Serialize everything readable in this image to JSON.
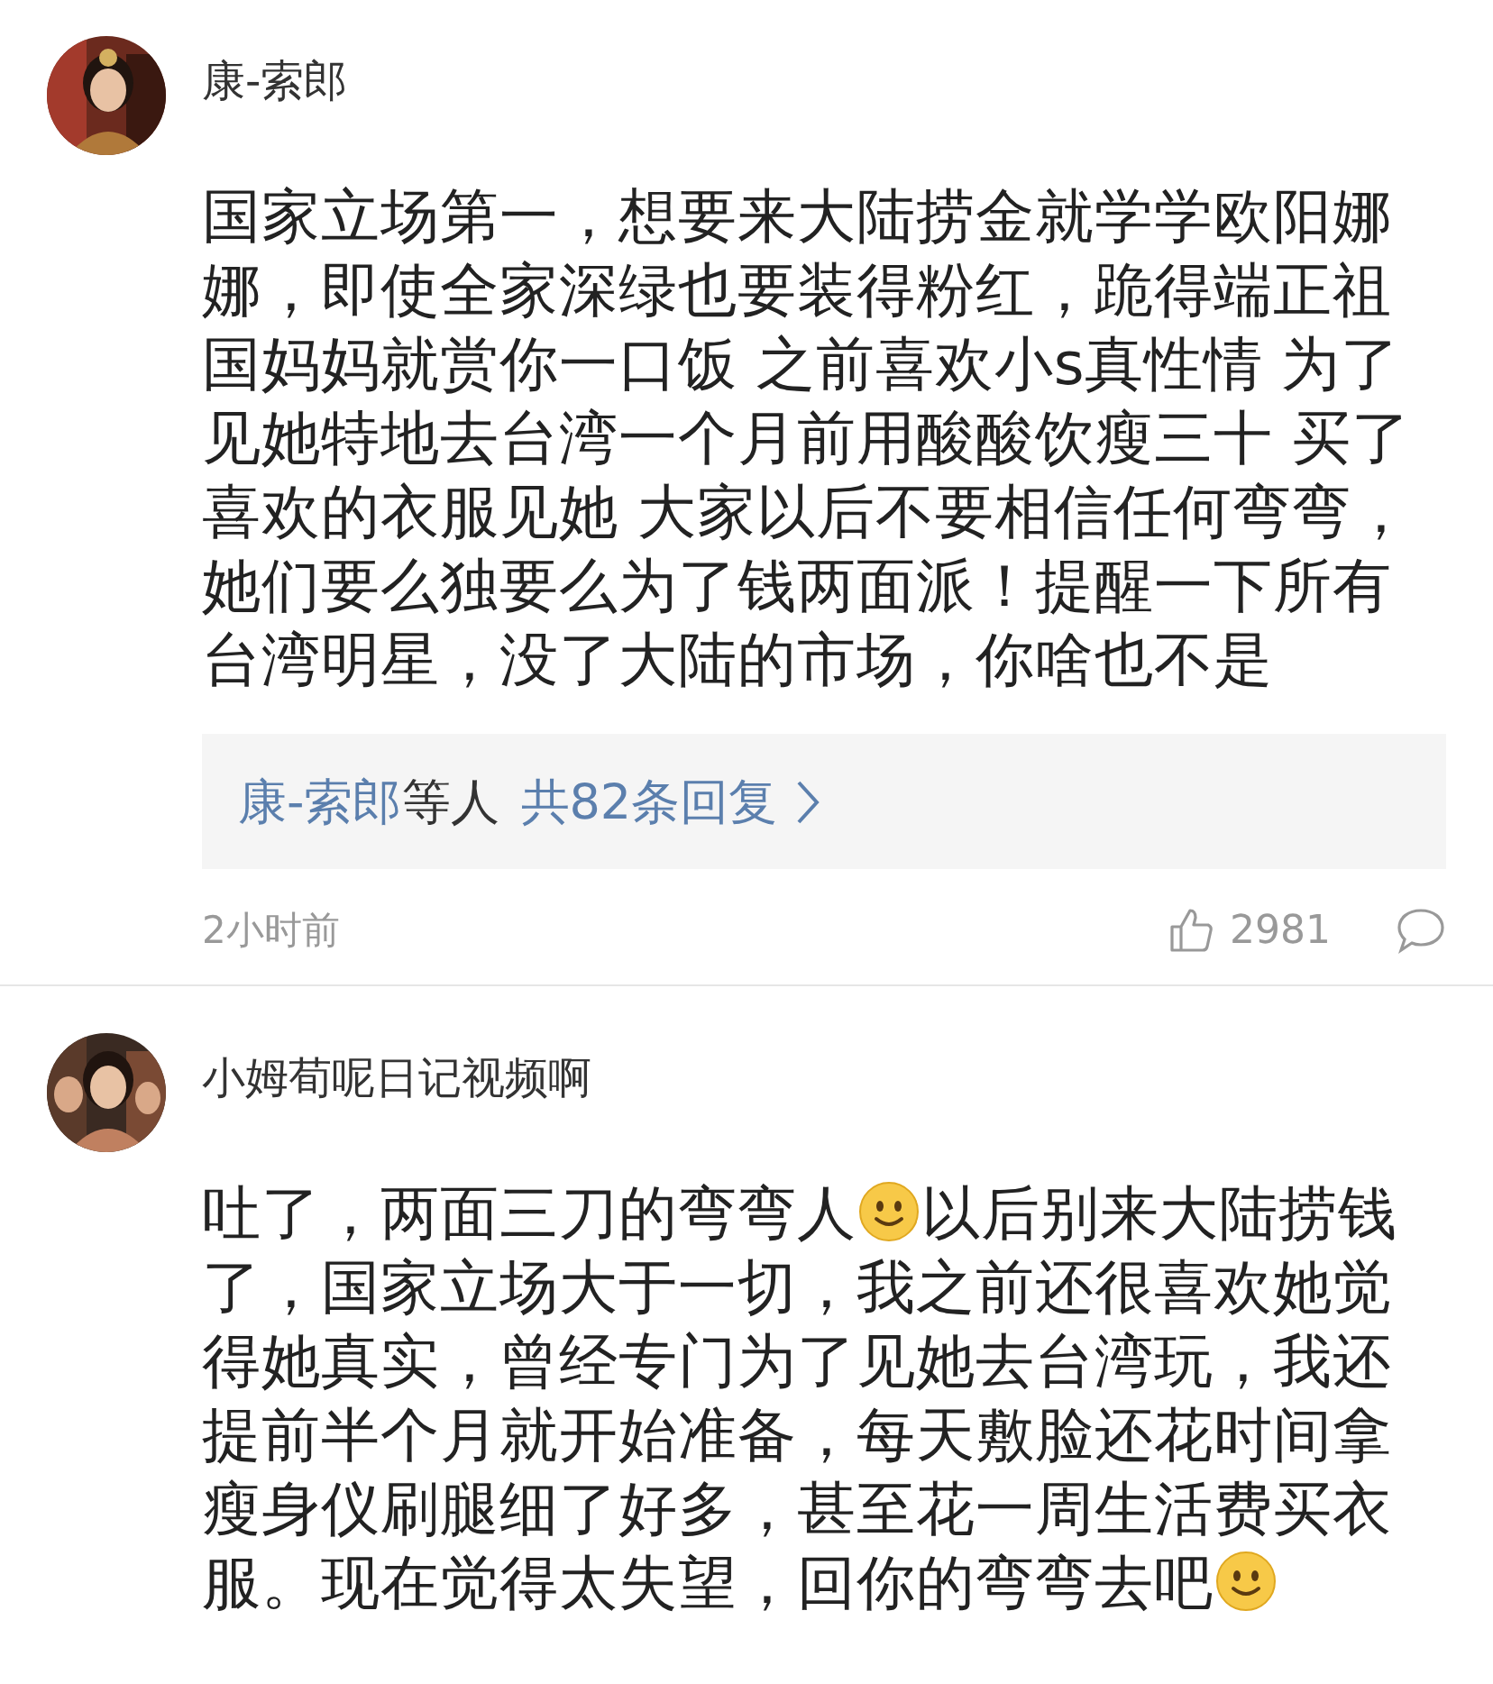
{
  "comments": [
    {
      "author": "康-索郎",
      "avatar": {
        "kind": "picture"
      },
      "body": [
        {
          "kind": "text",
          "text": "国家立场第一，想要来大陆捞金就学学欧阳娜娜，即使全家深绿也要装得粉红，跪得端正祖国妈妈就赏你一口饭 之前喜欢小s真性情 为了见她特地去台湾一个月前用酸酸饮瘦三十 买了喜欢的衣服见她 大家以后不要相信任何弯弯，她们要么独要么为了钱两面派！提醒一下所有台湾明星，没了大陆的市场，你啥也不是"
        }
      ],
      "replies": {
        "names": "康-索郎",
        "suffix": "等人",
        "total": "共82条回复"
      },
      "time": "2小时前",
      "likes": "2981"
    },
    {
      "author": "小姆荀呢日记视频啊",
      "avatar": {
        "kind": "picture"
      },
      "body": [
        {
          "kind": "text",
          "text": "吐了，两面三刀的弯弯人"
        },
        {
          "kind": "emoji"
        },
        {
          "kind": "text",
          "text": "以后别来大陆捞钱"
        },
        {
          "kind": "text",
          "text": "了，国家立场大于一切，我之前还很喜欢她觉得她真实，曾经专门为了见她去台湾玩，我还提前半个月就开始准备，每天敷脸还花时间拿瘦身仪刷腿细了好多，甚至花一周生活费买衣"
        },
        {
          "kind": "text",
          "text": "服。现在觉得太失望，回你的弯弯去吧"
        },
        {
          "kind": "emoji"
        }
      ]
    }
  ]
}
